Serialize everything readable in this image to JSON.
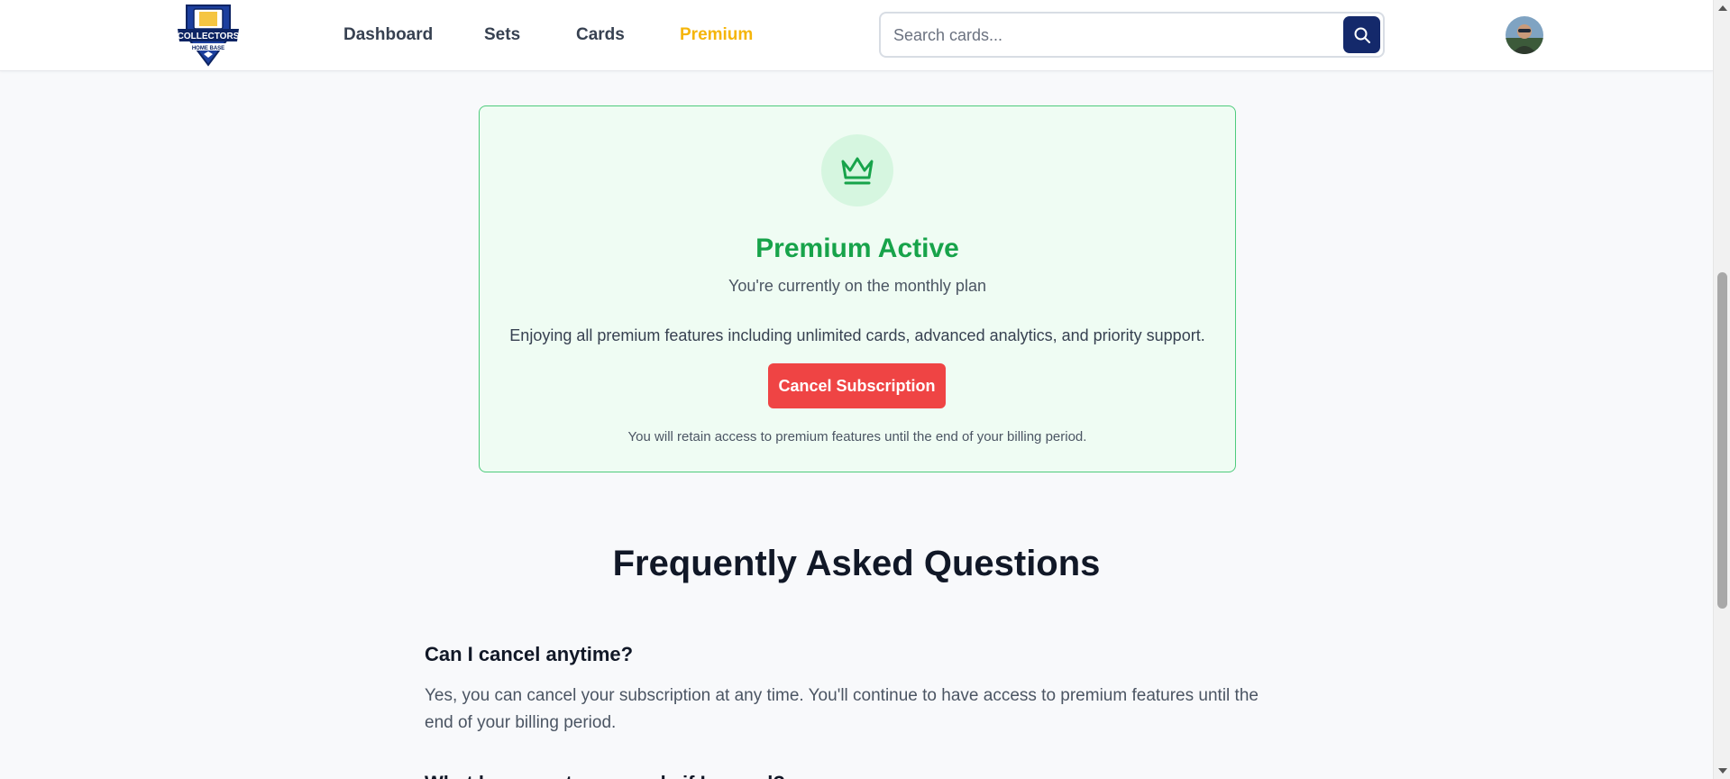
{
  "header": {
    "logo_alt": "Collectors Home Base",
    "logo_text_top": "COLLECTORS",
    "logo_text_bottom": "HOME BASE",
    "nav": [
      {
        "label": "Dashboard",
        "active": false
      },
      {
        "label": "Sets",
        "active": false
      },
      {
        "label": "Cards",
        "active": false
      },
      {
        "label": "Premium",
        "active": true
      }
    ],
    "search": {
      "placeholder": "Search cards...",
      "value": "",
      "icon": "search-icon"
    },
    "avatar_icon": "user-avatar"
  },
  "premium": {
    "icon": "crown-icon",
    "title": "Premium Active",
    "subtitle": "You're currently on the monthly plan",
    "description": "Enjoying all premium features including unlimited cards, advanced analytics, and priority support.",
    "cancel_label": "Cancel Subscription",
    "note": "You will retain access to premium features until the end of your billing period."
  },
  "faq": {
    "title": "Frequently Asked Questions",
    "items": [
      {
        "question": "Can I cancel anytime?",
        "answer": "Yes, you can cancel your subscription at any time. You'll continue to have access to premium features until the end of your billing period."
      },
      {
        "question": "What happens to my cards if I cancel?",
        "answer": ""
      }
    ]
  },
  "colors": {
    "accent_nav": "#f5b50a",
    "success": "#17a34a",
    "danger": "#ef4444",
    "search_button": "#14296b"
  }
}
